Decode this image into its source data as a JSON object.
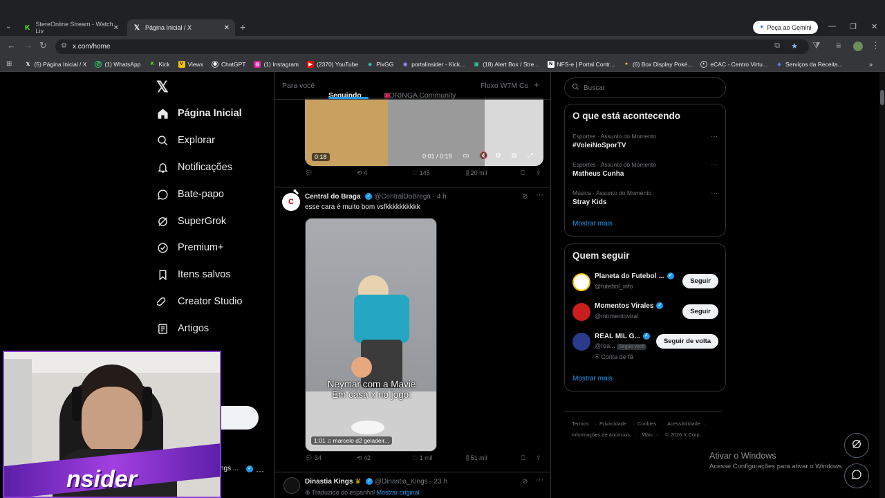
{
  "browser": {
    "tabs": [
      {
        "title": "StereOnline Stream - Watch Liv"
      },
      {
        "title": "Página Inicial / X"
      }
    ],
    "url": "x.com/home",
    "gemini_label": "Peça ao Gemini",
    "bookmarks": [
      "(5) Página Inicial / X",
      "(1) WhatsApp",
      "Kick",
      "Viewx",
      "ChatGPT",
      "(1) Instagram",
      "(2370) YouTube",
      "PixGG",
      "portalinsider - Kick...",
      "(18) Alert Box / Stre...",
      "NFS-e | Portal Contr...",
      "(6) Box Display Poké...",
      "eCAC - Centro Virtu...",
      "Serviços da Receita..."
    ]
  },
  "nav": {
    "items": [
      {
        "label": "Página Inicial"
      },
      {
        "label": "Explorar"
      },
      {
        "label": "Notificações"
      },
      {
        "label": "Bate-papo"
      },
      {
        "label": "SuperGrok"
      },
      {
        "label": "Premium+"
      },
      {
        "label": "Itens salvos"
      },
      {
        "label": "Creator Studio"
      },
      {
        "label": "Artigos"
      }
    ],
    "profile_name_fragment": "ngs ..."
  },
  "feed": {
    "tabs": [
      "Para você",
      "Seguindo",
      "CORINGA Community",
      "Fluxo W7M Co"
    ],
    "post0": {
      "video_duration": "0:18",
      "video_time": "0:01 / 0:19",
      "replies": "",
      "reposts": "4",
      "likes": "145",
      "views": "20 mil"
    },
    "post1": {
      "name": "Central do Braga",
      "handle": "@CentralDoBrega",
      "time": "4 h",
      "text": "esse cara é muito bom vsfkkkkkkkkkk",
      "video_caption_line1": "Neymar com a Mavie",
      "video_caption_line2": "Em casa x no jogo:",
      "video_duration": "1:01",
      "video_sound": "marcelo d2 geladeir...",
      "replies": "34",
      "reposts": "42",
      "likes": "1 mil",
      "views": "51 mil"
    },
    "post2": {
      "name": "Dinastia Kings",
      "handle": "@Dinastia_Kings",
      "time": "23 h",
      "subtext": "Traduzido do espanhol",
      "subtext_link": "Mostrar original"
    }
  },
  "sidebar": {
    "search_placeholder": "Buscar",
    "trends_title": "O que está acontecendo",
    "trends": [
      {
        "meta": "Esportes · Assunto do Momento",
        "name": "#VoleiNoSporTV"
      },
      {
        "meta": "Esportes · Assunto do Momento",
        "name": "Matheus Cunha"
      },
      {
        "meta": "Música · Assunto do Momento",
        "name": "Stray Kids"
      }
    ],
    "show_more": "Mostrar mais",
    "who_title": "Quem seguir",
    "who": [
      {
        "name": "Planeta do Futebol ...",
        "handle": "@futebol_info",
        "button": "Seguir"
      },
      {
        "name": "Momentos Virales",
        "handle": "@momentoviral",
        "button": "Seguir"
      },
      {
        "name": "REAL MIL G...",
        "handle": "@rea...",
        "badge": "Segue você",
        "extra": "Conta de fã",
        "button": "Seguir de volta"
      }
    ],
    "footer": [
      "Termos",
      "Privacidade",
      "Cookies",
      "Acessibilidade",
      "Informações de anúncios",
      "Mais ···",
      "© 2026 X Corp."
    ]
  },
  "windows_watermark": {
    "line1": "Ativar o Windows",
    "line2": "Acesse Configurações para ativar o Windows."
  },
  "overlay": {
    "brand_text": "nsider"
  }
}
